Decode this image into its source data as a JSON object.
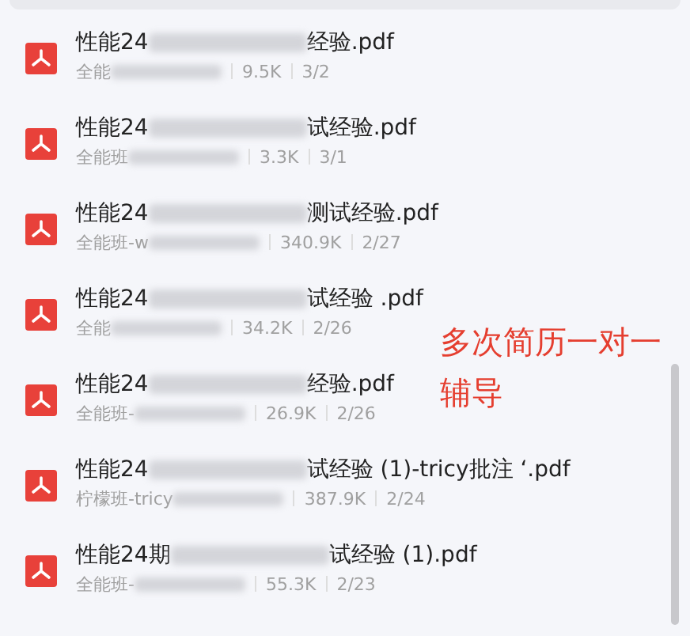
{
  "files": [
    {
      "name_start": "性能24",
      "name_end": "经验.pdf",
      "owner": "全能",
      "size": "9.5K",
      "pages": "3/2"
    },
    {
      "name_start": "性能24",
      "name_end": "试经验.pdf",
      "owner": "全能班",
      "size": "3.3K",
      "pages": "3/1"
    },
    {
      "name_start": "性能24",
      "name_end": "测试经验.pdf",
      "owner": "全能班-w",
      "size": "340.9K",
      "pages": "2/27"
    },
    {
      "name_start": "性能24",
      "name_end": "试经验 .pdf",
      "owner": "全能",
      "size": "34.2K",
      "pages": "2/26"
    },
    {
      "name_start": "性能24",
      "name_end": "经验.pdf",
      "owner": "全能班-",
      "size": "26.9K",
      "pages": "2/26"
    },
    {
      "name_start": "性能24",
      "name_end": "试经验 (1)-tricy批注 ‘.pdf",
      "owner": "柠檬班-tricy",
      "size": "387.9K",
      "pages": "2/24"
    },
    {
      "name_start": "性能24期",
      "name_end": "试经验 (1).pdf",
      "owner": "全能班-",
      "size": "55.3K",
      "pages": "2/23"
    }
  ],
  "annotation": "多次简历一对一辅导"
}
